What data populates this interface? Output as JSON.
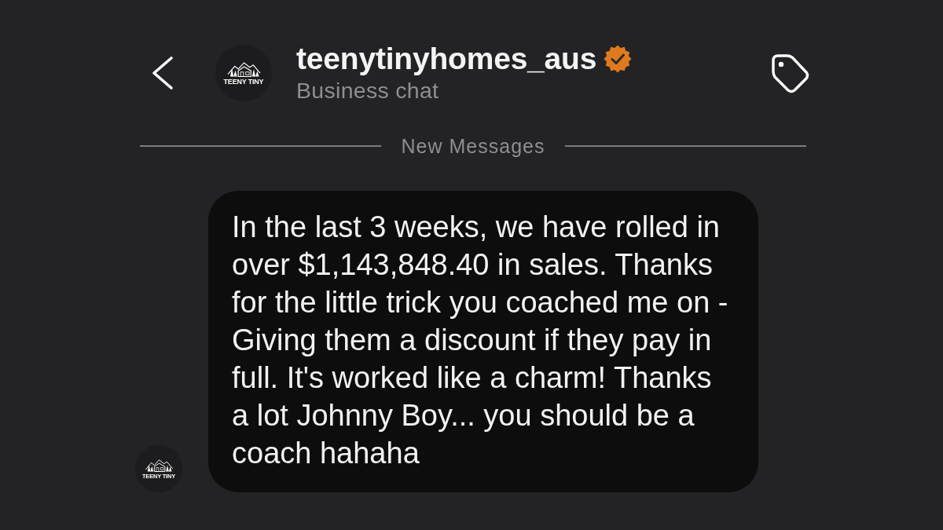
{
  "header": {
    "avatar": {
      "wordmark": "TEENY TINY"
    },
    "name": "teenytinyhomes_aus",
    "verified": true,
    "subtitle": "Business chat"
  },
  "divider": {
    "label": "New Messages"
  },
  "messages": [
    {
      "kind": "incoming",
      "avatar": {
        "wordmark": "TEENY TINY"
      },
      "text": "In the last 3 weeks, we have rolled in over $1,143,848.40 in sales. Thanks for the little trick you coached me on - Giving them a discount if they pay in full. It's worked like a charm! Thanks a lot Johnny Boy... you should be a coach hahaha"
    }
  ]
}
